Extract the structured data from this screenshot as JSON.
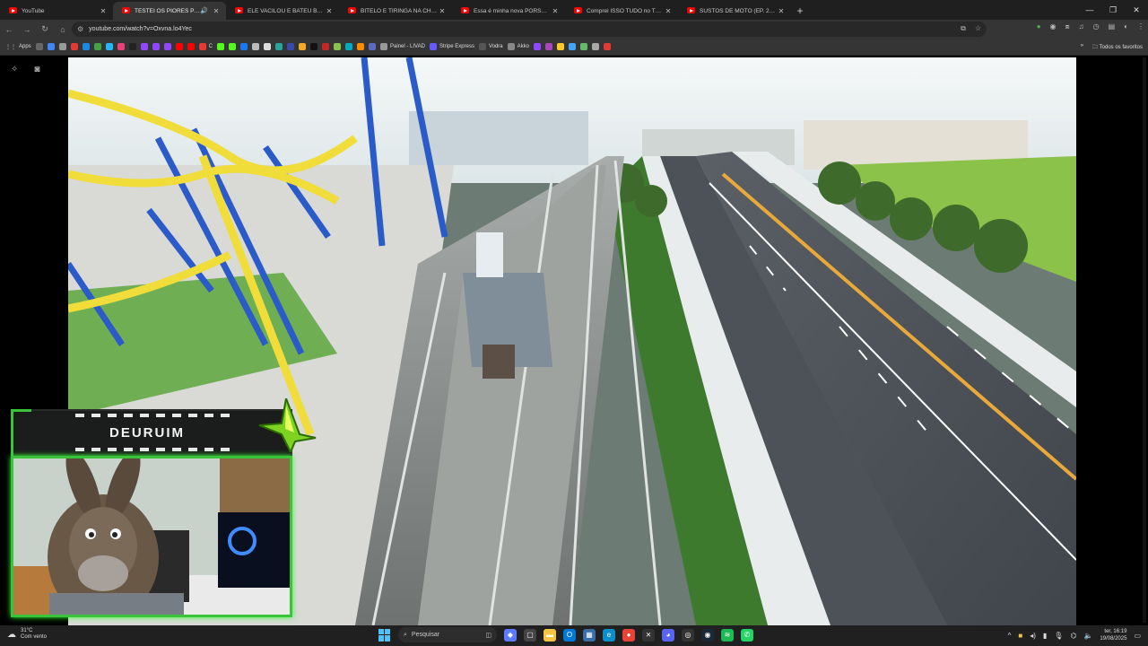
{
  "tabs": [
    {
      "label": "YouTube",
      "active": false,
      "audio": false
    },
    {
      "label": "TESTEI OS PIORES PARQUE",
      "active": true,
      "audio": true
    },
    {
      "label": "ELE VACILOU E BATEU BEM DE",
      "active": false,
      "audio": false
    },
    {
      "label": "BITELO E TIRINGA NA CHÁCAR",
      "active": false,
      "audio": false
    },
    {
      "label": "Essa é minha nova PORSCHE 9",
      "active": false,
      "audio": false
    },
    {
      "label": "Comprei ISSO TUDO no TÉDIO",
      "active": false,
      "audio": false
    },
    {
      "label": "SUSTOS DE MOTO (EP. 228) - Y",
      "active": false,
      "audio": false
    }
  ],
  "address": {
    "url": "youtube.com/watch?v=Oxvna.lo4Yec"
  },
  "bookmarks": {
    "apps_label": "Apps",
    "items": [
      "C",
      "Painel - LIVAD",
      "Stripe Express",
      "Vodra",
      "Akko"
    ],
    "all_label": "Todos os favoritos"
  },
  "overlay": {
    "streamer_name": "DEURUIM"
  },
  "taskbar": {
    "weather_temp": "31°C",
    "weather_desc": "Com vento",
    "search_placeholder": "Pesquisar",
    "time": "ter, 16:19",
    "date": "19/08/2025"
  },
  "colors": {
    "tab_bg": "#1f1f1f",
    "toolbar_bg": "#353535",
    "accent_green": "#39c43a",
    "youtube_red": "#ff0000"
  }
}
